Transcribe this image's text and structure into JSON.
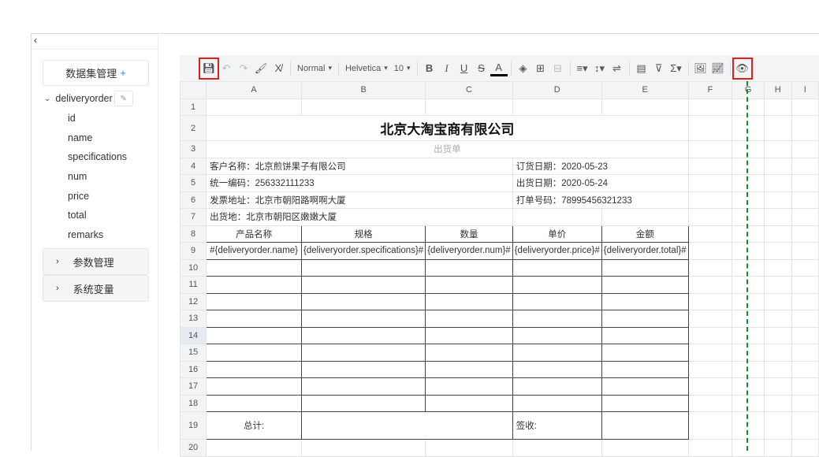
{
  "sidebar": {
    "collapse": "‹",
    "dataset_button": "数据集管理",
    "dataset_plus": "+",
    "dataset_name": "deliveryorder",
    "fields": [
      "id",
      "name",
      "specifications",
      "num",
      "price",
      "total",
      "remarks"
    ],
    "groups": [
      "参数管理",
      "系统变量"
    ]
  },
  "toolbar": {
    "style": "Normal",
    "font": "Helvetica",
    "size": "10"
  },
  "columns": [
    "A",
    "B",
    "C",
    "D",
    "E",
    "F",
    "G",
    "H",
    "I"
  ],
  "rows": [
    {
      "n": "1",
      "cells": []
    },
    {
      "n": "2",
      "cells": [
        "北京大淘宝商有限公司"
      ]
    },
    {
      "n": "3",
      "cells": [
        "出货单"
      ]
    },
    {
      "n": "4",
      "cells": [
        "客户名称：北京煎饼果子有限公司",
        "订货日期：2020-05-23"
      ]
    },
    {
      "n": "5",
      "cells": [
        "统一编码：256332111233",
        "出货日期：2020-05-24"
      ]
    },
    {
      "n": "6",
      "cells": [
        "发票地址：北京市朝阳路啊啊大厦",
        "打单号码：78995456321233"
      ]
    },
    {
      "n": "7",
      "cells": [
        "出货地：北京市朝阳区嫩嫩大厦"
      ]
    },
    {
      "n": "8",
      "cells": [
        "产品名称",
        "规格",
        "数量",
        "单价",
        "金额"
      ]
    },
    {
      "n": "9",
      "cells": [
        "#{deliveryorder.name}",
        "#{deliveryorder.specifications}",
        "#{deliveryorder.num}",
        "#{deliveryorder.price}",
        "#{deliveryorder.total}"
      ]
    },
    {
      "n": "10",
      "cells": []
    },
    {
      "n": "11",
      "cells": []
    },
    {
      "n": "12",
      "cells": []
    },
    {
      "n": "13",
      "cells": []
    },
    {
      "n": "14",
      "cells": []
    },
    {
      "n": "15",
      "cells": []
    },
    {
      "n": "16",
      "cells": []
    },
    {
      "n": "17",
      "cells": []
    },
    {
      "n": "18",
      "cells": []
    },
    {
      "n": "19",
      "cells": [
        "总计:",
        "签收:"
      ]
    },
    {
      "n": "20",
      "cells": []
    }
  ],
  "active_row": "14",
  "colors": {
    "highlight": "#e02020",
    "page_break": "#1a8a2a",
    "accent": "#1890ff"
  }
}
